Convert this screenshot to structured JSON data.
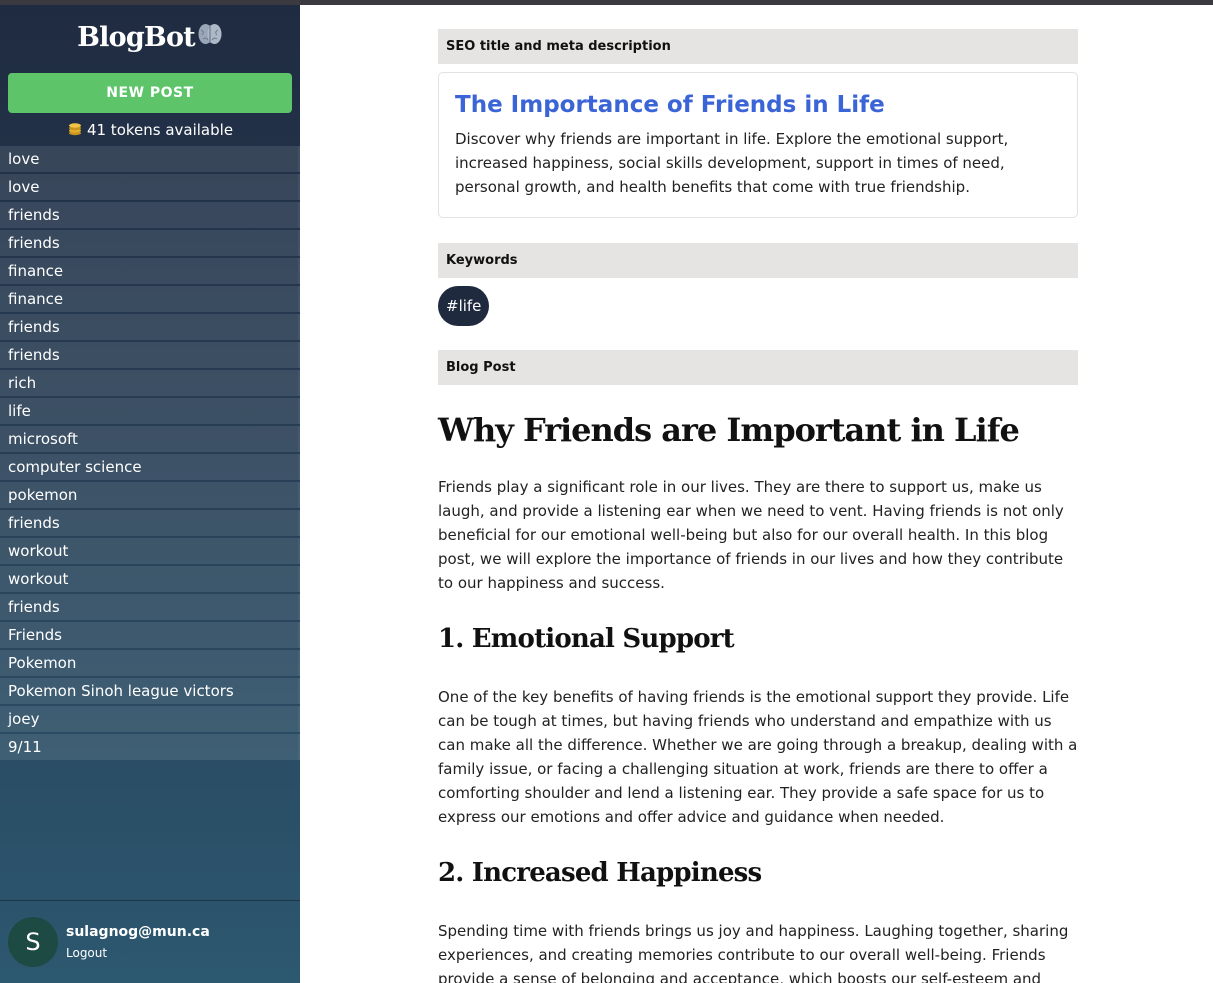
{
  "app": {
    "name": "BlogBot",
    "new_post_label": "NEW POST",
    "tokens_text": "41 tokens available"
  },
  "sidebar": {
    "topics": [
      "love",
      "love",
      "friends",
      "friends",
      "finance",
      "finance",
      "friends",
      "friends",
      "rich",
      "life",
      "microsoft",
      "computer science",
      "pokemon",
      "friends",
      "workout",
      "workout",
      "friends",
      "Friends",
      "Pokemon",
      "Pokemon Sinoh league victors",
      "joey",
      "9/11"
    ]
  },
  "user": {
    "initial": "S",
    "email": "sulagnog@mun.ca",
    "logout_label": "Logout"
  },
  "main": {
    "seo_header": "SEO title and meta description",
    "seo_title": "The Importance of Friends in Life",
    "seo_description": "Discover why friends are important in life. Explore the emotional support, increased happiness, social skills development, support in times of need, personal growth, and health benefits that come with true friendship.",
    "keywords_header": "Keywords",
    "keywords": [
      "#life"
    ],
    "post_header": "Blog Post",
    "post": {
      "title": "Why Friends are Important in Life",
      "intro": "Friends play a significant role in our lives. They are there to support us, make us laugh, and provide a listening ear when we need to vent. Having friends is not only beneficial for our emotional well-being but also for our overall health. In this blog post, we will explore the importance of friends in our lives and how they contribute to our happiness and success.",
      "sections": [
        {
          "heading": "1. Emotional Support",
          "body": "One of the key benefits of having friends is the emotional support they provide. Life can be tough at times, but having friends who understand and empathize with us can make all the difference. Whether we are going through a breakup, dealing with a family issue, or facing a challenging situation at work, friends are there to offer a comforting shoulder and lend a listening ear. They provide a safe space for us to express our emotions and offer advice and guidance when needed."
        },
        {
          "heading": "2. Increased Happiness",
          "body": "Spending time with friends brings us joy and happiness. Laughing together, sharing experiences, and creating memories contribute to our overall well-being. Friends provide a sense of belonging and acceptance, which boosts our self-esteem and"
        }
      ]
    }
  },
  "icons": {
    "logo_icon": "brain-icon",
    "tokens_icon": "coins-icon"
  },
  "colors": {
    "new_post_button": "#5ec46a",
    "seo_title": "#3b65d6",
    "keyword_pill": "#1f2a3e",
    "sidebar_top": "#1f2b40",
    "sidebar_bottom": "#2c5870"
  }
}
